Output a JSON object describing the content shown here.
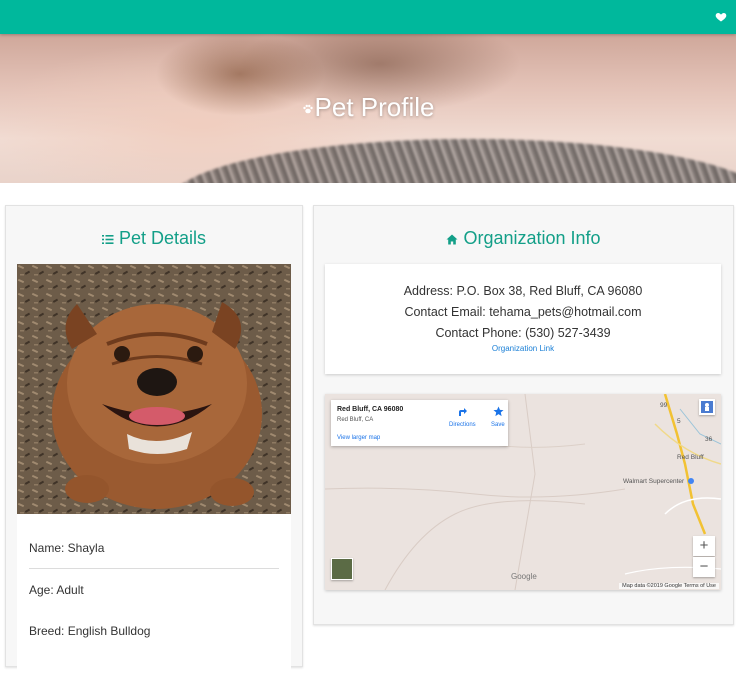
{
  "header": {
    "favorite_icon": "heart-icon",
    "bar_color": "#00b89c"
  },
  "hero": {
    "title": "Pet Profile",
    "icon": "paw-icon"
  },
  "pet_details": {
    "title": "Pet Details",
    "icon": "list-icon",
    "name": "Name: Shayla",
    "age": "Age: Adult",
    "breed": "Breed: English Bulldog"
  },
  "organization": {
    "title": "Organization Info",
    "icon": "home-icon",
    "address": "Address: P.O. Box 38, Red Bluff, CA 96080",
    "email": "Contact Email: tehama_pets@hotmail.com",
    "phone": "Contact Phone: (530) 527-3439",
    "link": "Organization Link"
  },
  "map": {
    "place_title": "Red Bluff, CA 96080",
    "place_sub": "Red Bluff, CA",
    "directions": "Directions",
    "save": "Save",
    "view_larger": "View larger map",
    "city_label": "Red Bluff",
    "store_label": "Walmart Supercenter",
    "zoom_in": "+",
    "zoom_out": "−",
    "google": "Google",
    "attribution": "Map data ©2019 Google   Terms of Use",
    "route_5": "5",
    "route_36": "36",
    "route_99": "99"
  },
  "colors": {
    "accent": "#139f88",
    "link": "#1a7fd6"
  }
}
